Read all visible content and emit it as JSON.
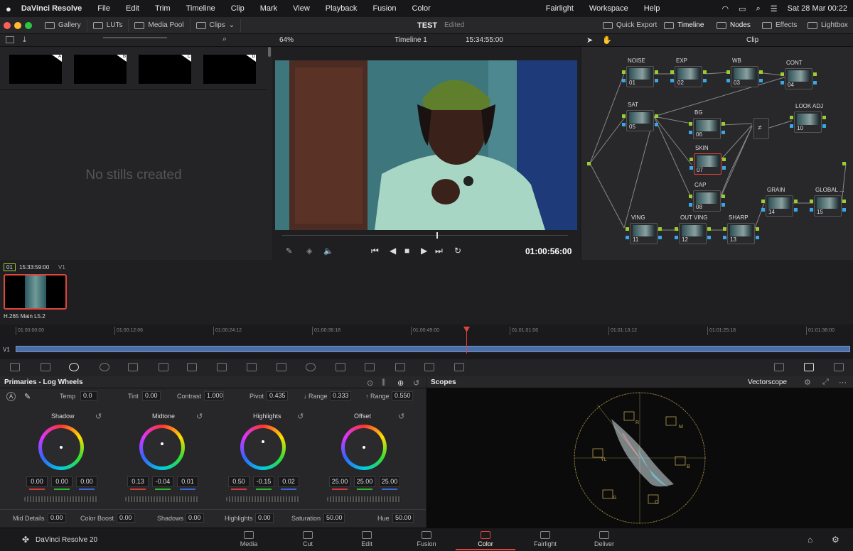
{
  "menubar": {
    "app_name": "DaVinci Resolve",
    "items": [
      "File",
      "Edit",
      "Trim",
      "Timeline",
      "Clip",
      "Mark",
      "View",
      "Playback",
      "Fusion",
      "Color"
    ],
    "right_items": [
      "Fairlight",
      "Workspace",
      "Help"
    ],
    "datetime": "Sat 28 Mar  00:22"
  },
  "toolbar": {
    "gallery": "Gallery",
    "luts": "LUTs",
    "media_pool": "Media Pool",
    "clips": "Clips",
    "project_title": "TEST",
    "project_status": "Edited",
    "quick_export": "Quick Export",
    "timeline": "Timeline",
    "nodes": "Nodes",
    "effects": "Effects",
    "lightbox": "Lightbox"
  },
  "viewer_bar": {
    "zoom": "64%",
    "timeline_name": "Timeline 1",
    "timecode": "15:34:55:00",
    "mode": "Clip"
  },
  "gallery": {
    "stills": [
      {
        "label": "A"
      },
      {
        "label": "B"
      },
      {
        "label": "C"
      },
      {
        "label": "D"
      }
    ],
    "empty_text": "No stills created"
  },
  "viewer": {
    "current_timecode": "01:00:56:00",
    "scrub_position": 0.54
  },
  "nodes": [
    {
      "label": "NOISE",
      "num": "01"
    },
    {
      "label": "EXP",
      "num": "02"
    },
    {
      "label": "WB",
      "num": "03"
    },
    {
      "label": "CONT",
      "num": "04"
    },
    {
      "label": "SAT",
      "num": "05"
    },
    {
      "label": "BG",
      "num": "06"
    },
    {
      "label": "SKIN",
      "num": "07"
    },
    {
      "label": "CAP",
      "num": "08"
    },
    {
      "label": "LOOK ADJ",
      "num": "10"
    },
    {
      "label": "VING",
      "num": "11"
    },
    {
      "label": "OUT VING",
      "num": "12"
    },
    {
      "label": "SHARP",
      "num": "13"
    },
    {
      "label": "GRAIN",
      "num": "14"
    },
    {
      "label": "GLOBAL ...",
      "num": "15"
    }
  ],
  "clips": {
    "index": "01",
    "timecode": "15:33:59:00",
    "track": "V1",
    "codec": "H.265 Main L5.2"
  },
  "timeline": {
    "track": "V1",
    "ticks": [
      "01:00:00:00",
      "01:00:12:06",
      "01:00:24:12",
      "01:00:36:18",
      "01:00:49:00",
      "01:01:01:06",
      "01:01:13:12",
      "01:01:25:18",
      "01:01:38:00"
    ],
    "playhead_fraction": 0.54
  },
  "primaries": {
    "title": "Primaries - Log Wheels",
    "params": {
      "temp_label": "Temp",
      "temp": "0.0",
      "tint_label": "Tint",
      "tint": "0.00",
      "contrast_label": "Contrast",
      "contrast": "1.000",
      "pivot_label": "Pivot",
      "pivot": "0.435",
      "low_range_label": "↓ Range",
      "low_range": "0.333",
      "high_range_label": "↑ Range",
      "high_range": "0.550"
    },
    "wheels": [
      {
        "name": "Shadow",
        "values": [
          "0.00",
          "0.00",
          "0.00"
        ]
      },
      {
        "name": "Midtone",
        "values": [
          "0.13",
          "-0.04",
          "0.01"
        ]
      },
      {
        "name": "Highlights",
        "values": [
          "0.50",
          "-0.15",
          "0.02"
        ]
      },
      {
        "name": "Offset",
        "values": [
          "25.00",
          "25.00",
          "25.00"
        ]
      }
    ],
    "bottom": {
      "mid_details_label": "Mid Details",
      "mid_details": "0.00",
      "color_boost_label": "Color Boost",
      "color_boost": "0.00",
      "shadows_label": "Shadows",
      "shadows": "0.00",
      "highlights_label": "Highlights",
      "highlights": "0.00",
      "saturation_label": "Saturation",
      "saturation": "50.00",
      "hue_label": "Hue",
      "hue": "50.00"
    }
  },
  "scopes": {
    "title": "Scopes",
    "type": "Vectorscope",
    "targets": [
      "R",
      "M",
      "B",
      "C",
      "G",
      "YL"
    ]
  },
  "bottom_bar": {
    "product": "DaVinci Resolve 20",
    "tabs": [
      {
        "label": "Media",
        "active": false
      },
      {
        "label": "Cut",
        "active": false
      },
      {
        "label": "Edit",
        "active": false
      },
      {
        "label": "Fusion",
        "active": false
      },
      {
        "label": "Color",
        "active": true
      },
      {
        "label": "Fairlight",
        "active": false
      },
      {
        "label": "Deliver",
        "active": false
      }
    ]
  },
  "colors": {
    "accent_red": "#e0443a",
    "node_green": "#9acd32",
    "node_blue": "#39a7e8",
    "scope_ring": "#b8a14a"
  }
}
